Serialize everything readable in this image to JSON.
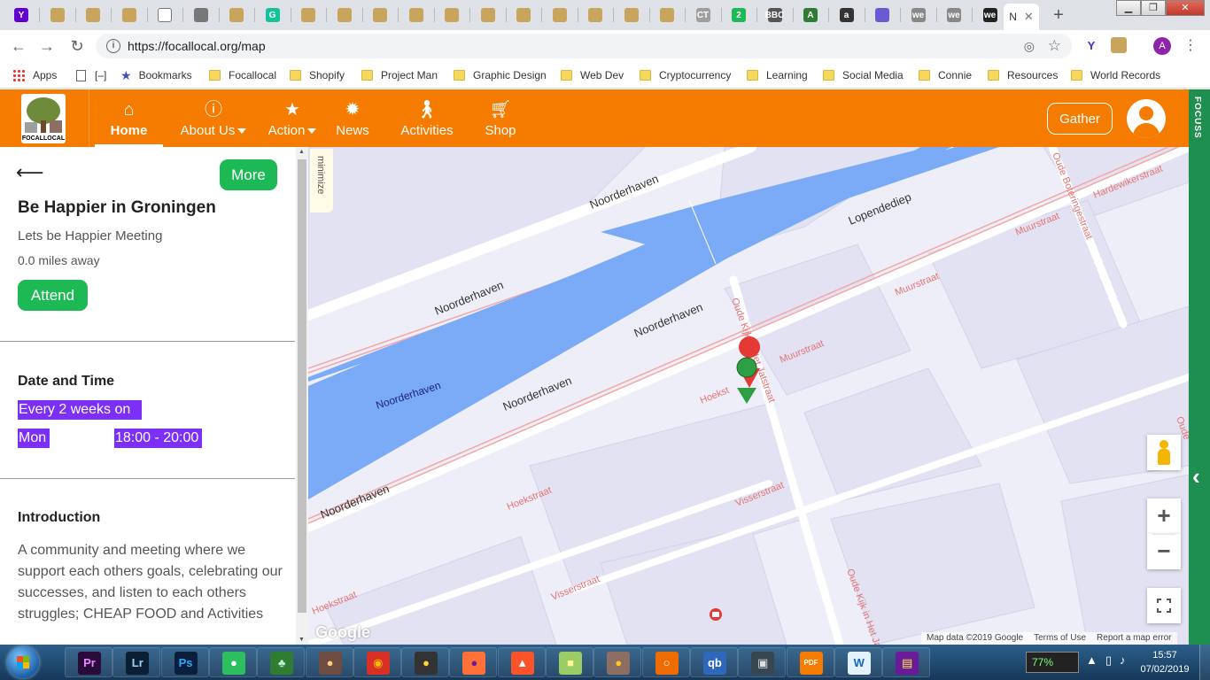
{
  "browser": {
    "url": "https://focallocal.org/map",
    "active_tab_label": "N",
    "tabs": [
      {
        "icon": "yahoo-icon",
        "glyph": "Y",
        "color": "#6001d2"
      },
      {
        "icon": "focallocal-icon",
        "glyph": "",
        "color": "#c9a45c"
      },
      {
        "icon": "focallocal-icon",
        "glyph": "",
        "color": "#c9a45c"
      },
      {
        "icon": "focallocal-icon",
        "glyph": "",
        "color": "#c9a45c"
      },
      {
        "icon": "document-icon",
        "glyph": "",
        "color": "#ffffff"
      },
      {
        "icon": "cube-icon",
        "glyph": "",
        "color": "#777777"
      },
      {
        "icon": "focallocal-icon",
        "glyph": "",
        "color": "#c9a45c"
      },
      {
        "icon": "grammarly-icon",
        "glyph": "G",
        "color": "#15c39a"
      },
      {
        "icon": "focallocal-icon",
        "glyph": "",
        "color": "#c9a45c"
      },
      {
        "icon": "focallocal-icon",
        "glyph": "",
        "color": "#c9a45c"
      },
      {
        "icon": "focallocal-icon",
        "glyph": "",
        "color": "#c9a45c"
      },
      {
        "icon": "focallocal-icon",
        "glyph": "",
        "color": "#c9a45c"
      },
      {
        "icon": "focallocal-icon",
        "glyph": "",
        "color": "#c9a45c"
      },
      {
        "icon": "focallocal-icon",
        "glyph": "",
        "color": "#c9a45c"
      },
      {
        "icon": "focallocal-icon",
        "glyph": "",
        "color": "#c9a45c"
      },
      {
        "icon": "focallocal-icon",
        "glyph": "",
        "color": "#c9a45c"
      },
      {
        "icon": "focallocal-icon",
        "glyph": "",
        "color": "#c9a45c"
      },
      {
        "icon": "focallocal-icon",
        "glyph": "",
        "color": "#c9a45c"
      },
      {
        "icon": "focallocal-icon",
        "glyph": "",
        "color": "#c9a45c"
      },
      {
        "icon": "ct-icon",
        "glyph": "CT",
        "color": "#9e9e9e"
      },
      {
        "icon": "number-2-icon",
        "glyph": "2",
        "color": "#1db954"
      },
      {
        "icon": "bbc-icon",
        "glyph": "BBC",
        "color": "#555555"
      },
      {
        "icon": "market-icon",
        "glyph": "A",
        "color": "#2e7d32"
      },
      {
        "icon": "amazon-icon",
        "glyph": "a",
        "color": "#333333"
      },
      {
        "icon": "puzzle-icon",
        "glyph": "",
        "color": "#6b5bd2"
      },
      {
        "icon": "we-icon",
        "glyph": "we",
        "color": "#888888"
      },
      {
        "icon": "we-icon",
        "glyph": "we",
        "color": "#888888"
      },
      {
        "icon": "we-icon",
        "glyph": "we",
        "color": "#222222"
      }
    ],
    "bookmarks": [
      {
        "label": "Apps",
        "kind": "apps"
      },
      {
        "label": "[–]",
        "kind": "page"
      },
      {
        "label": "Bookmarks",
        "kind": "star"
      },
      {
        "label": "Focallocal",
        "kind": "folder"
      },
      {
        "label": "Shopify",
        "kind": "folder"
      },
      {
        "label": "Project Man",
        "kind": "folder"
      },
      {
        "label": "Graphic Design",
        "kind": "folder"
      },
      {
        "label": "Web Dev",
        "kind": "folder"
      },
      {
        "label": "Cryptocurrency",
        "kind": "folder"
      },
      {
        "label": "Learning",
        "kind": "folder"
      },
      {
        "label": "Social Media",
        "kind": "folder"
      },
      {
        "label": "Connie",
        "kind": "folder"
      },
      {
        "label": "Resources",
        "kind": "folder"
      },
      {
        "label": "World Records",
        "kind": "folder"
      }
    ],
    "profile_initial": "A"
  },
  "header": {
    "logo_text": "FOCALLOCAL",
    "nav": [
      {
        "label": "Home",
        "icon": "home-icon",
        "active": true,
        "dropdown": false
      },
      {
        "label": "About Us",
        "icon": "info-icon",
        "active": false,
        "dropdown": true
      },
      {
        "label": "Action",
        "icon": "star-icon",
        "active": false,
        "dropdown": true
      },
      {
        "label": "News",
        "icon": "sun-icon",
        "active": false,
        "dropdown": false
      },
      {
        "label": "Activities",
        "icon": "walking-person-icon",
        "active": false,
        "dropdown": false
      },
      {
        "label": "Shop",
        "icon": "cart-icon",
        "active": false,
        "dropdown": false
      }
    ],
    "gather_label": "Gather",
    "accent": "#f57c00"
  },
  "extension_strip": {
    "label": "FOCUSS",
    "color": "#1e8f4e"
  },
  "panel": {
    "more_label": "More",
    "title": "Be Happier in Groningen",
    "subtitle": "Lets be Happier Meeting",
    "distance": "0.0 miles away",
    "attend_label": "Attend",
    "date_time_heading": "Date and Time",
    "recurrence": "Every 2 weeks on",
    "day": "Mon",
    "time": "18:00 - 20:00",
    "intro_heading": "Introduction",
    "intro_text": "A community and meeting where we support each others goals, celebrating our successes, and listen to each others struggles; CHEAP FOOD and Activities",
    "button_color": "#1db954",
    "highlight_color": "#7b2ff7"
  },
  "map": {
    "minimize_label": "minimize",
    "google_label": "Google",
    "footer": [
      "Map data ©2019 Google",
      "Terms of Use",
      "Report a map error"
    ],
    "streets": {
      "noorderhaven": "Noorderhaven",
      "lopendediep": "Lopendediep",
      "muurstraat": "Muurstraat",
      "oude_kijk": "Oude Kijk in Het Jatstraat",
      "oude_boteringe": "Oude Boteringestraat",
      "hardewikerstraat": "Hardewikerstraat",
      "hoekstraat": "Hoekstraat",
      "visserstraat": "Visserstraat",
      "hoekst": "Hoekst",
      "oude": "Oude"
    },
    "water_color": "#7baaf7",
    "marker_colors": [
      "#e53935",
      "#2e9e44"
    ]
  },
  "taskbar": {
    "battery": "77%",
    "time": "15:57",
    "date": "07/02/2019",
    "apps": [
      {
        "name": "premiere-icon",
        "glyph": "Pr",
        "bg": "#2a0a3a",
        "fg": "#e58bff"
      },
      {
        "name": "lightroom-icon",
        "glyph": "Lr",
        "bg": "#0b1f33",
        "fg": "#9fd3ff"
      },
      {
        "name": "photoshop-icon",
        "glyph": "Ps",
        "bg": "#0a1f3c",
        "fg": "#31a8ff"
      },
      {
        "name": "evernote-icon",
        "glyph": "●",
        "bg": "#2dbe60",
        "fg": "#ffffff"
      },
      {
        "name": "clover-icon",
        "glyph": "♣",
        "bg": "#2e7d32",
        "fg": "#b9f6ca"
      },
      {
        "name": "creature-icon",
        "glyph": "●",
        "bg": "#6d4c41",
        "fg": "#ffcc80"
      },
      {
        "name": "chrome-icon",
        "glyph": "◉",
        "bg": "#d93025",
        "fg": "#fbbc04"
      },
      {
        "name": "bee-icon",
        "glyph": "●",
        "bg": "#333333",
        "fg": "#fdd835"
      },
      {
        "name": "firefox-icon",
        "glyph": "●",
        "bg": "#ff7139",
        "fg": "#6a1b9a"
      },
      {
        "name": "brave-icon",
        "glyph": "▲",
        "bg": "#fb542b",
        "fg": "#ffffff"
      },
      {
        "name": "sticky-notes-icon",
        "glyph": "■",
        "bg": "#9ccc65",
        "fg": "#fff59d"
      },
      {
        "name": "paint-icon",
        "glyph": "●",
        "bg": "#8d6e63",
        "fg": "#ffca28"
      },
      {
        "name": "search-tool-icon",
        "glyph": "○",
        "bg": "#ef6c00",
        "fg": "#ffffff"
      },
      {
        "name": "qbittorrent-icon",
        "glyph": "qb",
        "bg": "#2f67ba",
        "fg": "#ffffff"
      },
      {
        "name": "screen-tool-icon",
        "glyph": "▣",
        "bg": "#37474f",
        "fg": "#e0e0e0"
      },
      {
        "name": "pdf-icon",
        "glyph": "PDF",
        "bg": "#f57c00",
        "fg": "#ffffff"
      },
      {
        "name": "word-doc-icon",
        "glyph": "W",
        "bg": "#e3f2fd",
        "fg": "#1565c0"
      },
      {
        "name": "winrar-icon",
        "glyph": "▤",
        "bg": "#6a1b9a",
        "fg": "#ffeb3b"
      }
    ]
  }
}
